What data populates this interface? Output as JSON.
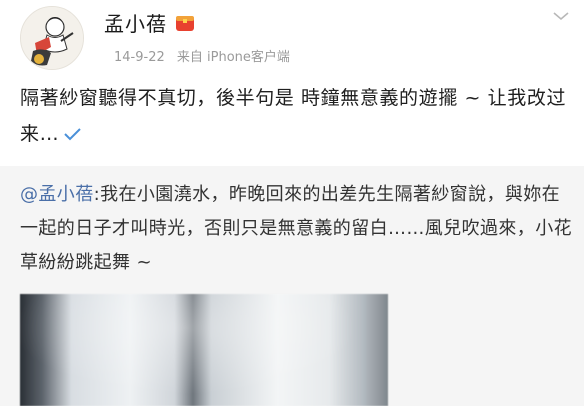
{
  "post": {
    "username": "孟小蓓",
    "date": "14-9-22",
    "source": "来自 iPhone客户端",
    "text": "隔著紗窗聽得不真切，後半句是 時鐘無意義的遊擺 ~ 让我改过来…"
  },
  "repost": {
    "mention": "@孟小蓓",
    "text": ":我在小園澆水，昨晚回來的出差先生隔著紗窗說，與妳在一起的日子才叫時光，否則只是無意義的留白……風兒吹過來，小花草紛紛跳起舞 ~"
  },
  "icons": {
    "vip": "vip-badge-icon",
    "options": "chevron-down-icon",
    "edited": "checkmark-icon"
  },
  "colors": {
    "mention": "#4a6fa8",
    "check": "#4a90d9",
    "vip": "#e8412f"
  }
}
